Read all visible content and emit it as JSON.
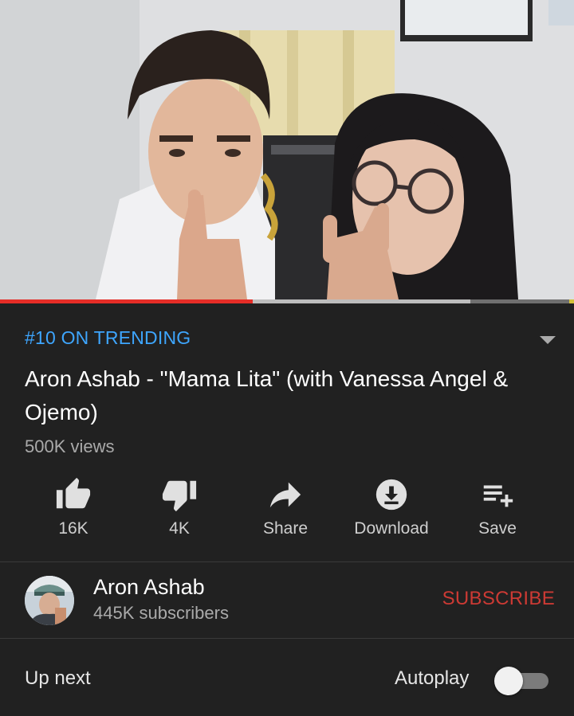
{
  "video": {
    "progress_played": 0.44,
    "progress_buffered": 0.82
  },
  "info": {
    "trending_label": "#10 ON TRENDING",
    "title": "Aron Ashab - \"Mama Lita\" (with Vanessa Angel & Ojemo)",
    "views": "500K views"
  },
  "actions": {
    "like_label": "16K",
    "dislike_label": "4K",
    "share_label": "Share",
    "download_label": "Download",
    "save_label": "Save"
  },
  "channel": {
    "name": "Aron Ashab",
    "subscribers": "445K subscribers",
    "subscribe_label": "SUBSCRIBE"
  },
  "up_next": {
    "label": "Up next",
    "autoplay_label": "Autoplay",
    "autoplay_on": false
  },
  "colors": {
    "background": "#212121",
    "trending": "#3ea6ff",
    "subscribe": "#cc3a34",
    "progress": "#e52d27"
  },
  "icons": [
    "like-icon",
    "dislike-icon",
    "share-icon",
    "download-icon",
    "playlist-add-icon",
    "chevron-down-icon"
  ]
}
